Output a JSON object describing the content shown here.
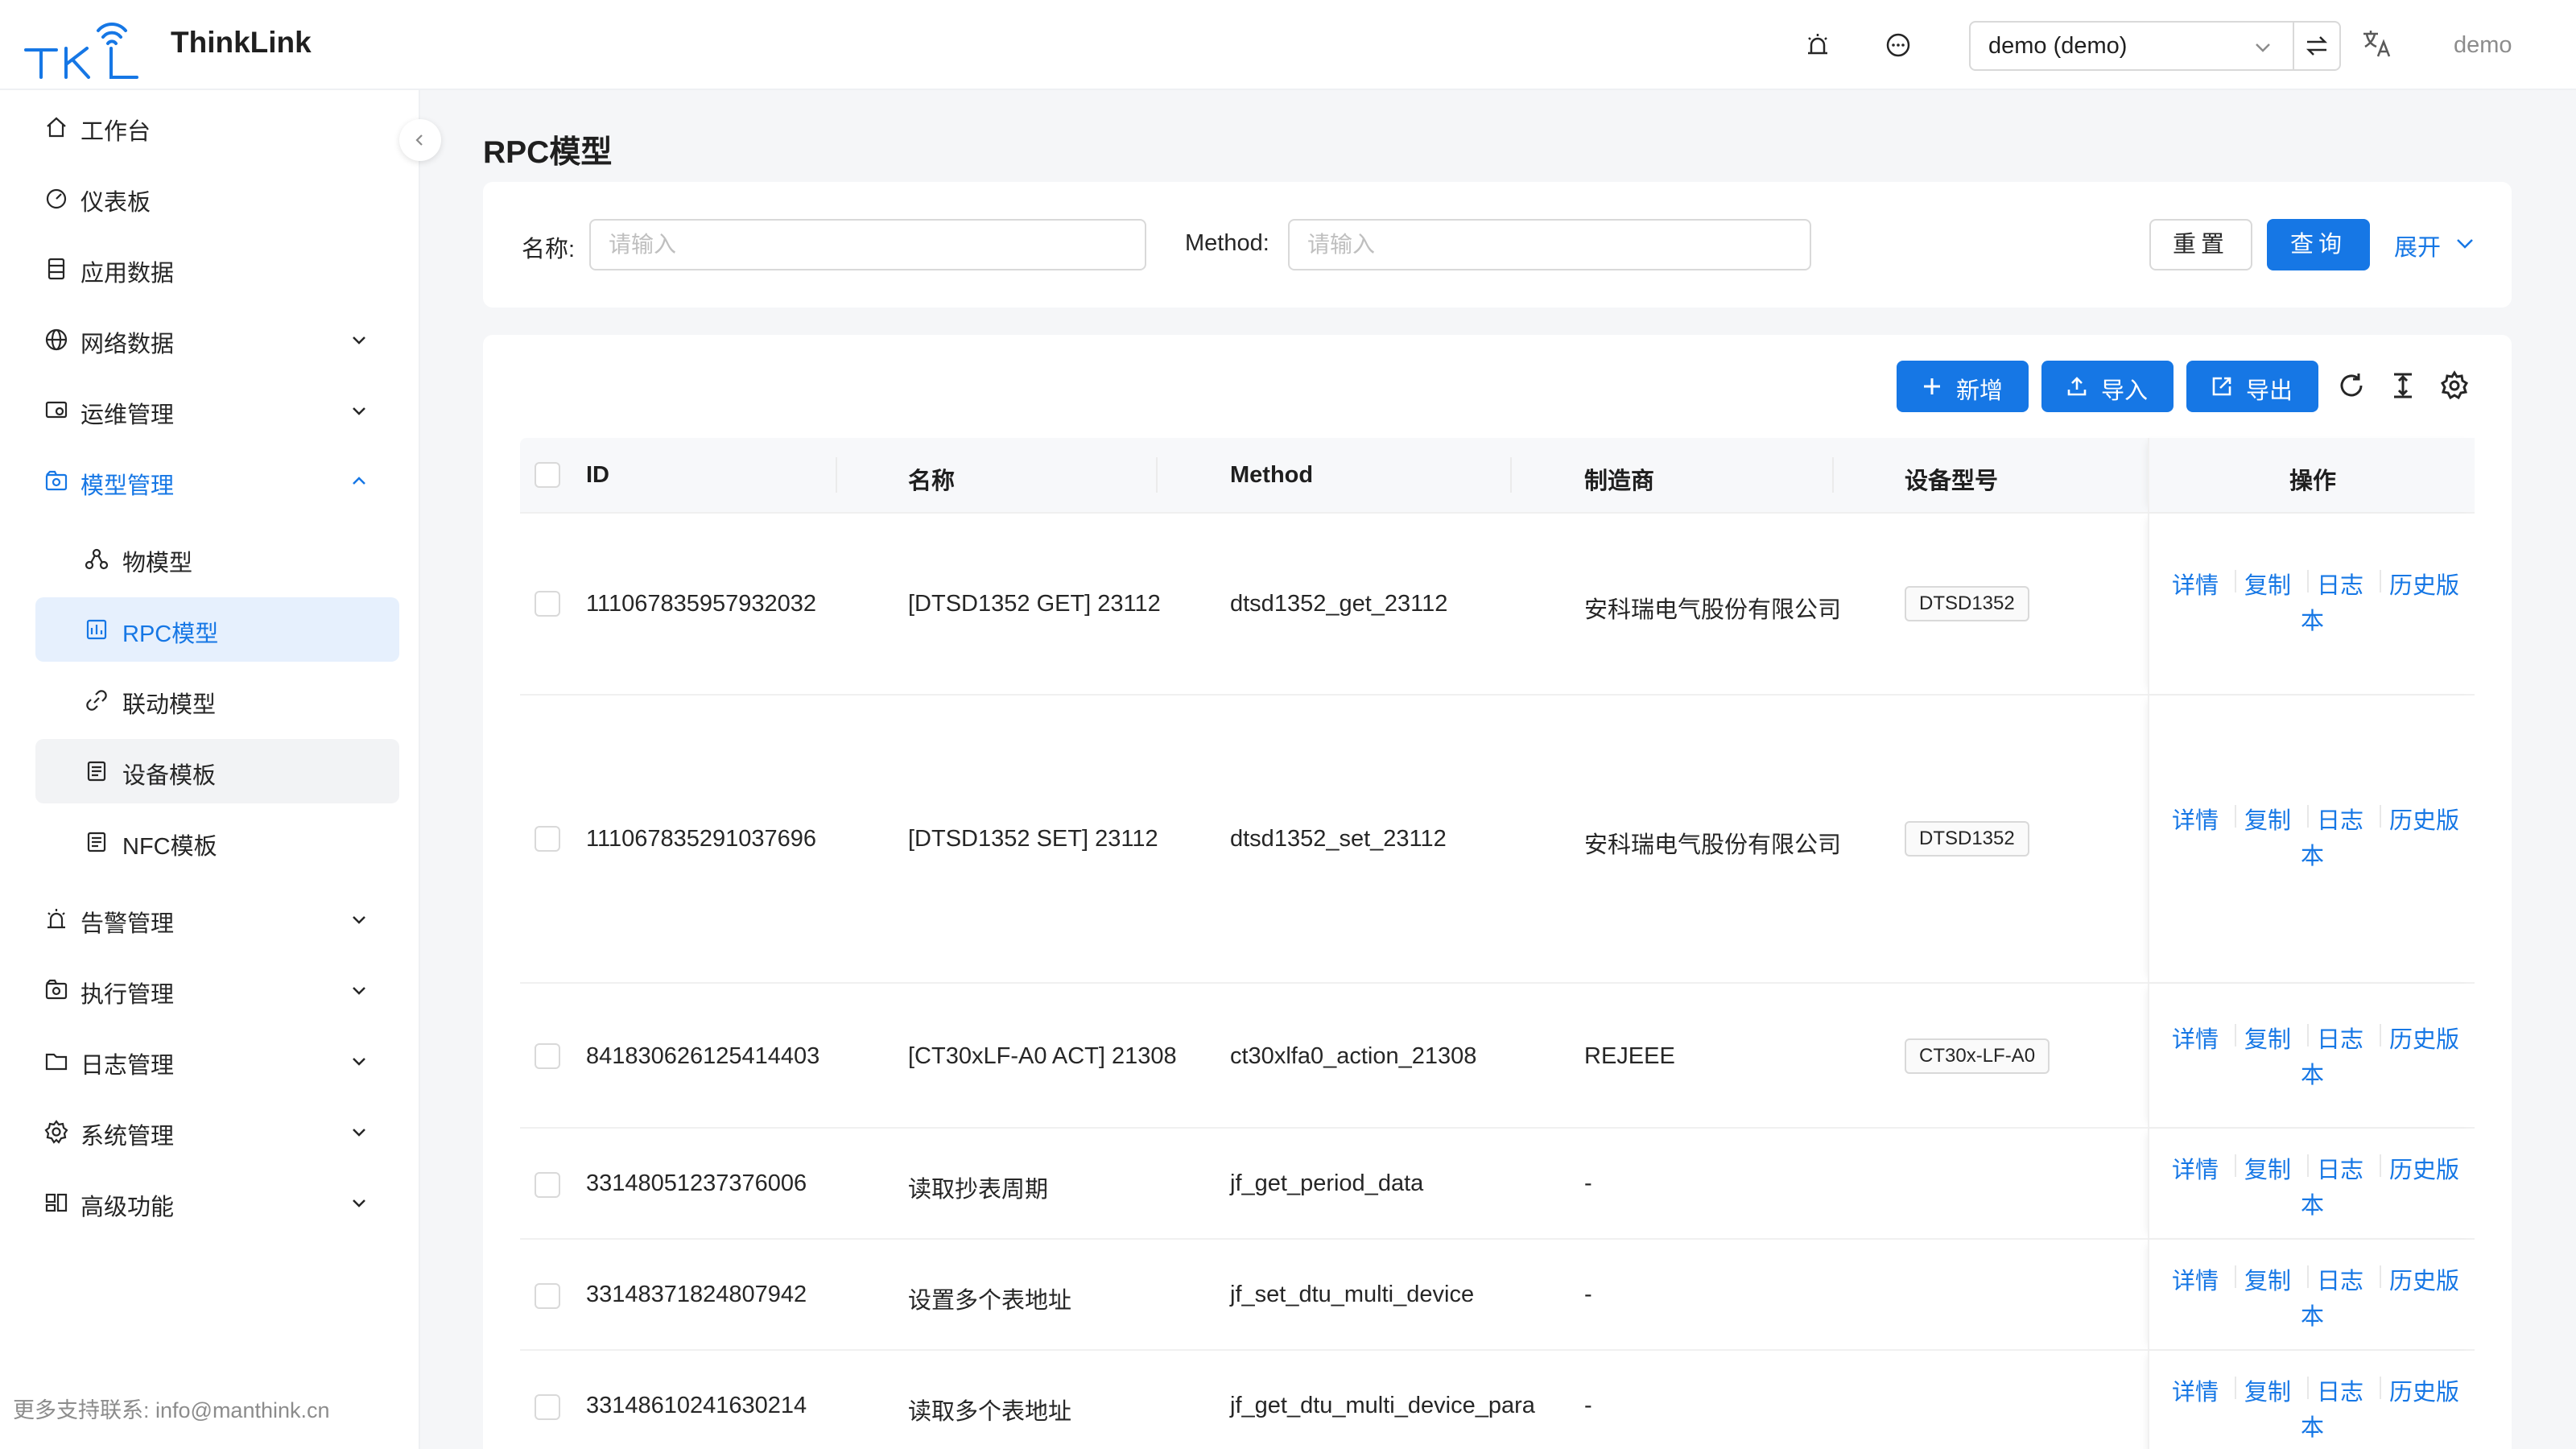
{
  "header": {
    "brand": "ThinkLink",
    "tenant": "demo (demo)",
    "user": "demo",
    "icons": [
      "alarm-icon",
      "message-icon",
      "swap-icon",
      "translate-icon"
    ]
  },
  "sidebar": {
    "items": [
      {
        "label": "工作台",
        "icon": "home-icon"
      },
      {
        "label": "仪表板",
        "icon": "dashboard-icon"
      },
      {
        "label": "应用数据",
        "icon": "data-icon"
      },
      {
        "label": "网络数据",
        "icon": "globe-icon"
      },
      {
        "label": "运维管理",
        "icon": "ops-icon"
      },
      {
        "label": "模型管理",
        "icon": "model-icon"
      },
      {
        "label": "物模型",
        "icon": "thing-model-icon"
      },
      {
        "label": "RPC模型",
        "icon": "rpc-icon"
      },
      {
        "label": "联动模型",
        "icon": "link-icon"
      },
      {
        "label": "设备模板",
        "icon": "template-icon"
      },
      {
        "label": "NFC模板",
        "icon": "nfc-icon"
      },
      {
        "label": "告警管理",
        "icon": "alarm-icon"
      },
      {
        "label": "执行管理",
        "icon": "execute-icon"
      },
      {
        "label": "日志管理",
        "icon": "folder-icon"
      },
      {
        "label": "系统管理",
        "icon": "gear-icon"
      },
      {
        "label": "高级功能",
        "icon": "advanced-icon"
      }
    ],
    "footer": "更多支持联系: info@manthink.cn"
  },
  "page": {
    "title": "RPC模型"
  },
  "filter": {
    "name_label": "名称:",
    "name_placeholder": "请输入",
    "method_label": "Method:",
    "method_placeholder": "请输入",
    "reset": "重置",
    "query": "查询",
    "expand": "展开"
  },
  "toolbar": {
    "add": "新增",
    "import": "导入",
    "export": "导出"
  },
  "table": {
    "columns": [
      "ID",
      "名称",
      "Method",
      "制造商",
      "设备型号",
      "操作"
    ],
    "actions": [
      "详情",
      "复制",
      "日志",
      "历史版",
      "本"
    ],
    "rows": [
      {
        "id": "111067835957932032",
        "name": "[DTSD1352 GET] 23112",
        "method": "dtsd1352_get_23112",
        "maker": "安科瑞电气股份有限公司",
        "model": "DTSD1352"
      },
      {
        "id": "111067835291037696",
        "name": "[DTSD1352 SET] 23112",
        "method": "dtsd1352_set_23112",
        "maker": "安科瑞电气股份有限公司",
        "model": "DTSD1352"
      },
      {
        "id": "841830626125414403",
        "name": "[CT30xLF-A0 ACT] 21308",
        "method": "ct30xlfa0_action_21308",
        "maker": "REJEEE",
        "model": "CT30x-LF-A0"
      },
      {
        "id": "33148051237376006",
        "name": "读取抄表周期",
        "method": "jf_get_period_data",
        "maker": "-",
        "model": ""
      },
      {
        "id": "33148371824807942",
        "name": "设置多个表地址",
        "method": "jf_set_dtu_multi_device",
        "maker": "-",
        "model": ""
      },
      {
        "id": "33148610241630214",
        "name": "读取多个表地址",
        "method": "jf_get_dtu_multi_device_para",
        "maker": "-",
        "model": ""
      }
    ]
  },
  "colors": {
    "primary": "#1677e5",
    "active_bg": "#e6f0fd"
  }
}
